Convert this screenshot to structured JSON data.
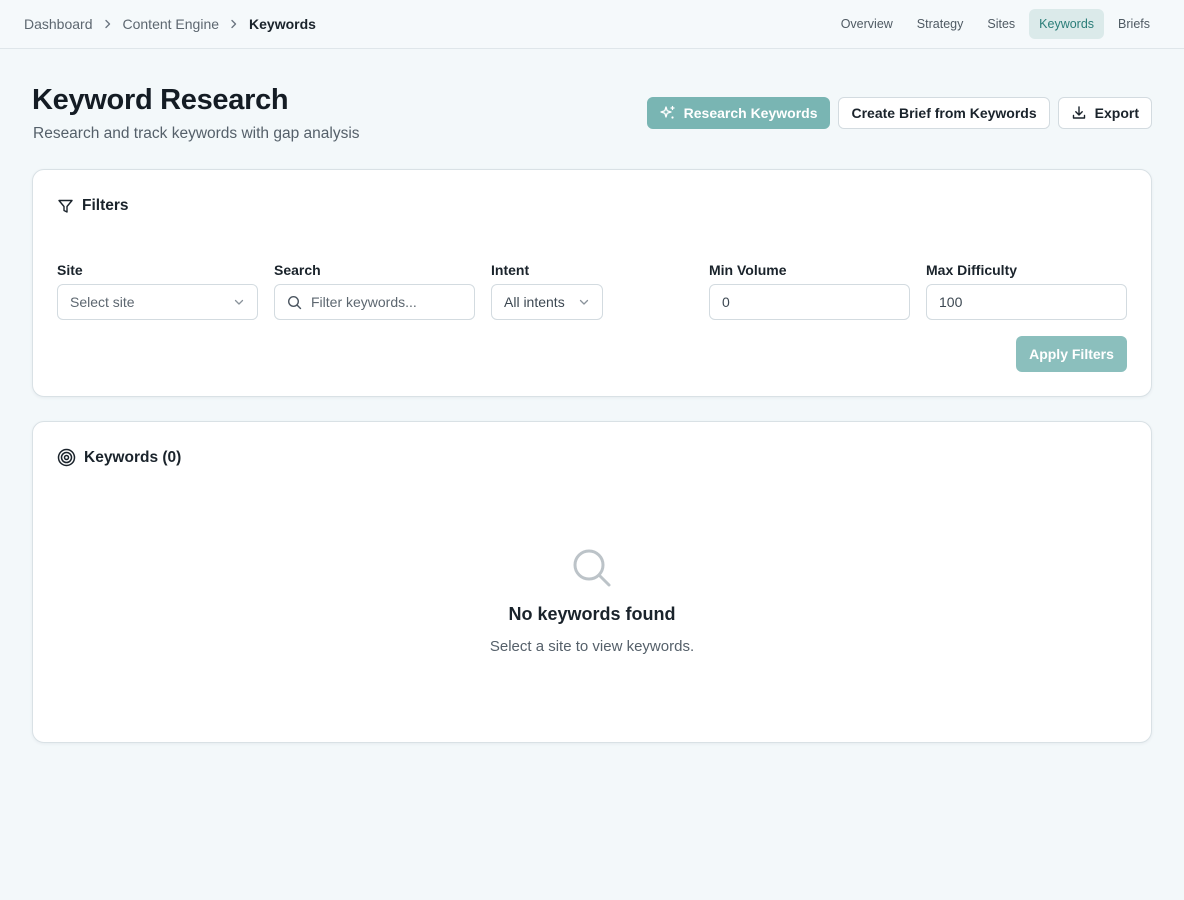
{
  "breadcrumb": {
    "items": [
      "Dashboard",
      "Content Engine",
      "Keywords"
    ]
  },
  "nav": {
    "items": [
      "Overview",
      "Strategy",
      "Sites",
      "Keywords",
      "Briefs"
    ],
    "active": "Keywords"
  },
  "header": {
    "title": "Keyword Research",
    "subtitle": "Research and track keywords with gap analysis"
  },
  "actions": {
    "research_label": "Research Keywords",
    "create_brief_label": "Create Brief from Keywords",
    "export_label": "Export"
  },
  "filters": {
    "title": "Filters",
    "site": {
      "label": "Site",
      "placeholder": "Select site"
    },
    "search": {
      "label": "Search",
      "placeholder": "Filter keywords..."
    },
    "intent": {
      "label": "Intent",
      "value": "All intents"
    },
    "min_volume": {
      "label": "Min Volume",
      "value": "0"
    },
    "max_difficulty": {
      "label": "Max Difficulty",
      "value": "100"
    },
    "apply_label": "Apply Filters"
  },
  "keywords": {
    "title": "Keywords (0)",
    "empty_title": "No keywords found",
    "empty_subtitle": "Select a site to view keywords."
  },
  "colors": {
    "accent": "#79b5b3",
    "accent_text": "#2a7d78",
    "background": "#f3f8fa"
  },
  "icons": {
    "breadcrumb_separator": "chevron-right-icon",
    "research": "sparkles-icon",
    "export": "download-icon",
    "filters": "filter-icon",
    "select": "chevron-down-icon",
    "search": "search-icon",
    "keywords": "target-icon",
    "empty": "search-icon"
  }
}
